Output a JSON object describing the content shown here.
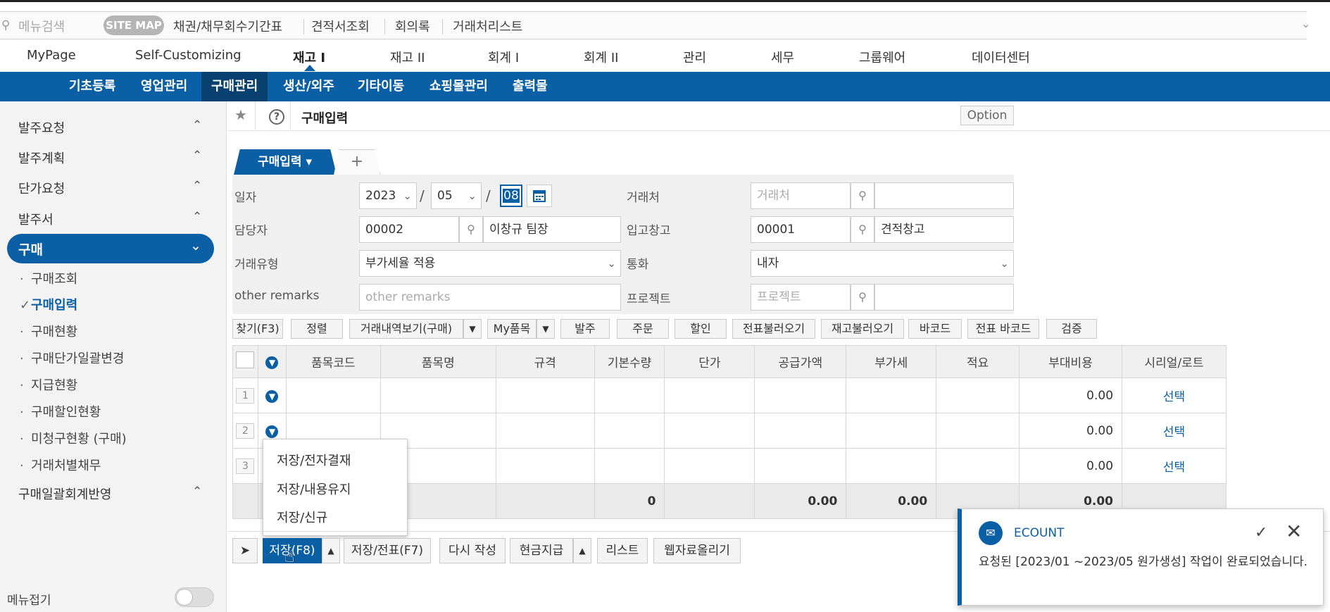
{
  "search": {
    "placeholder": "메뉴검색",
    "sitemap": "SITE MAP"
  },
  "quicklinks": [
    "채권/채무회수기간표",
    "견적서조회",
    "회의록",
    "거래처리스트"
  ],
  "mainnav": [
    "MyPage",
    "Self-Customizing",
    "재고 I",
    "재고 II",
    "회계 I",
    "회계 II",
    "관리",
    "세무",
    "그룹웨어",
    "데이터센터"
  ],
  "mainnav_active": "재고 I",
  "subnav": [
    "기초등록",
    "영업관리",
    "구매관리",
    "생산/외주",
    "기타이동",
    "쇼핑몰관리",
    "출력물"
  ],
  "subnav_active": "구매관리",
  "sidebar": {
    "groups_top": [
      "발주요청",
      "발주계획",
      "단가요청",
      "발주서"
    ],
    "active_group": "구매",
    "sub_items": [
      "구매조회",
      "구매입력",
      "구매현황",
      "구매단가일괄변경",
      "지급현황",
      "구매할인현황",
      "미청구현황 (구매)",
      "거래처별채무"
    ],
    "active_sub": "구매입력",
    "group_bottom": "구매일괄회계반영",
    "collapse_label": "메뉴접기"
  },
  "page": {
    "title": "구매입력",
    "option": "Option",
    "tab": "구매입력",
    "tab_add": "+"
  },
  "form": {
    "date_label": "일자",
    "year": "2023",
    "month": "05",
    "day": "08",
    "vendor_label": "거래처",
    "vendor_placeholder": "거래처",
    "manager_label": "담당자",
    "manager_code": "00002",
    "manager_name": "이창규 팀장",
    "warehouse_label": "입고창고",
    "warehouse_code": "00001",
    "warehouse_name": "견적창고",
    "trade_type_label": "거래유형",
    "trade_type": "부가세율 적용",
    "currency_label": "통화",
    "currency": "내자",
    "remarks_label": "other remarks",
    "remarks_placeholder": "other remarks",
    "project_label": "프로젝트",
    "project_placeholder": "프로젝트"
  },
  "toolbar": [
    "찾기(F3)",
    "정렬",
    "거래내역보기(구매)",
    "My품목",
    "발주",
    "주문",
    "할인",
    "전표불러오기",
    "재고불러오기",
    "바코드",
    "전표 바코드",
    "검증"
  ],
  "grid": {
    "headers": [
      "품목코드",
      "품목명",
      "규격",
      "기본수량",
      "단가",
      "공급가액",
      "부가세",
      "적요",
      "부대비용",
      "시리얼/로트"
    ],
    "rows": [
      {
        "num": "1",
        "extra": "0.00",
        "serial": "선택"
      },
      {
        "num": "2",
        "extra": "0.00",
        "serial": "선택"
      },
      {
        "num": "3",
        "extra": "0.00",
        "serial": "선택"
      }
    ],
    "totals": {
      "qty": "0",
      "supply": "0.00",
      "vat": "0.00",
      "extra": "0.00"
    }
  },
  "save_menu": [
    "저장/전자결재",
    "저장/내용유지",
    "저장/신규"
  ],
  "bottom_buttons": {
    "save": "저장(F8)",
    "save_slip": "저장/전표(F7)",
    "rewrite": "다시 작성",
    "cash": "현금지급",
    "list": "리스트",
    "web_upload": "웹자료올리기"
  },
  "toast": {
    "title": "ECOUNT",
    "message": "요청된 [2023/01 ~2023/05 원가생성] 작업이 완료되었습니다."
  },
  "colors": {
    "primary": "#0b5fa5",
    "primary_dark": "#08416f"
  }
}
